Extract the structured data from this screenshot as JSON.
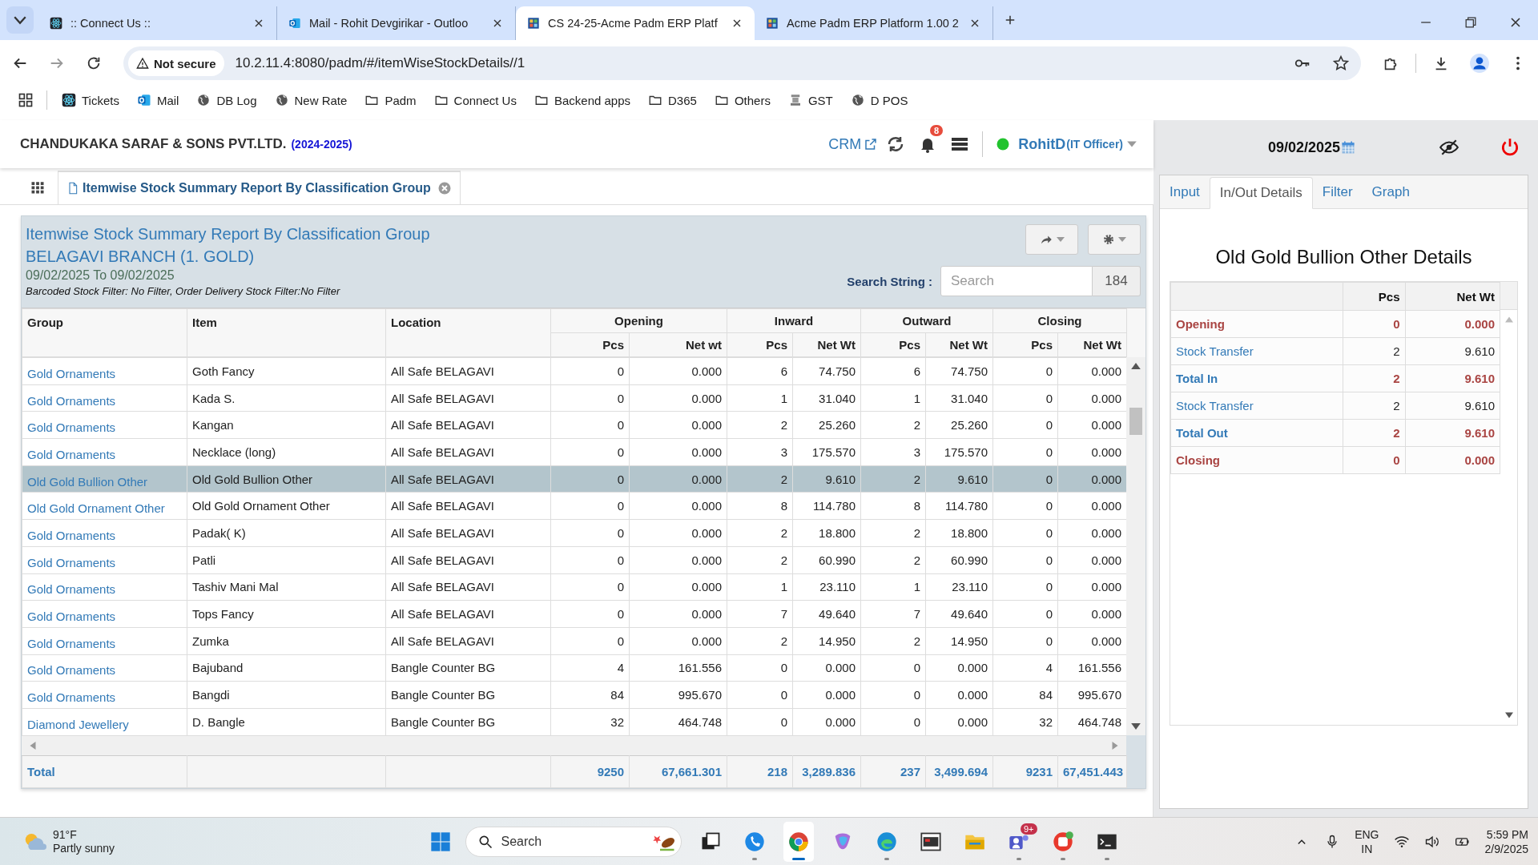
{
  "browser": {
    "tabs": [
      {
        "title": ":: Connect Us ::",
        "selected": false
      },
      {
        "title": "Mail - Rohit Devgirikar - Outloo",
        "selected": false
      },
      {
        "title": "CS 24-25-Acme Padm ERP Platf",
        "selected": true
      },
      {
        "title": "Acme Padm ERP Platform 1.00 2",
        "selected": false
      }
    ],
    "address": {
      "security": "Not secure",
      "url": "10.2.11.4:8080/padm/#/itemWiseStockDetails//1"
    },
    "bookmarks": [
      {
        "label": "Tickets",
        "kind": "app"
      },
      {
        "label": "Mail",
        "kind": "mail"
      },
      {
        "label": "DB Log",
        "kind": "site"
      },
      {
        "label": "New Rate",
        "kind": "site"
      },
      {
        "label": "Padm",
        "kind": "folder"
      },
      {
        "label": "Connect Us",
        "kind": "folder"
      },
      {
        "label": "Backend apps",
        "kind": "folder"
      },
      {
        "label": "D365",
        "kind": "folder"
      },
      {
        "label": "Others",
        "kind": "folder"
      },
      {
        "label": "GST",
        "kind": "emblem"
      },
      {
        "label": "D POS",
        "kind": "site"
      }
    ]
  },
  "header": {
    "company": "CHANDUKAKA SARAF & SONS PVT.LTD.",
    "year": "(2024-2025)",
    "crm": "CRM",
    "notifications": "8",
    "user": "RohitD",
    "role": "(IT Officer)"
  },
  "page_tabs": [
    {
      "label": "Itemwise Stock Summary Report By Classification Group",
      "selected": true
    }
  ],
  "report": {
    "title": "Itemwise Stock Summary Report By Classification Group",
    "branch": "BELAGAVI BRANCH (1. GOLD)",
    "date_range": "09/02/2025 To 09/02/2025",
    "filter_note": "Barcoded Stock Filter: No Filter, Order Delivery Stock Filter:No Filter",
    "search_label": "Search String :",
    "search": {
      "placeholder": "Search"
    },
    "count": "184",
    "table": {
      "columns": [
        "Group",
        "Item",
        "Location"
      ],
      "column_groups": [
        {
          "label": "Opening",
          "columns": [
            "Pcs",
            "Net wt"
          ]
        },
        {
          "label": "Inward",
          "columns": [
            "Pcs",
            "Net Wt"
          ]
        },
        {
          "label": "Outward",
          "columns": [
            "Pcs",
            "Net Wt"
          ]
        },
        {
          "label": "Closing",
          "columns": [
            "Pcs",
            "Net Wt"
          ]
        }
      ],
      "rows": [
        {
          "group": "Gold Ornaments",
          "item": "Goth Fancy",
          "location": "All Safe BELAGAVI",
          "values": [
            "0",
            "0.000",
            "6",
            "74.750",
            "6",
            "74.750",
            "0",
            "0.000"
          ],
          "selected": false
        },
        {
          "group": "Gold Ornaments",
          "item": "Kada S.",
          "location": "All Safe BELAGAVI",
          "values": [
            "0",
            "0.000",
            "1",
            "31.040",
            "1",
            "31.040",
            "0",
            "0.000"
          ],
          "selected": false
        },
        {
          "group": "Gold Ornaments",
          "item": "Kangan",
          "location": "All Safe BELAGAVI",
          "values": [
            "0",
            "0.000",
            "2",
            "25.260",
            "2",
            "25.260",
            "0",
            "0.000"
          ],
          "selected": false
        },
        {
          "group": "Gold Ornaments",
          "item": "Necklace (long)",
          "location": "All Safe BELAGAVI",
          "values": [
            "0",
            "0.000",
            "3",
            "175.570",
            "3",
            "175.570",
            "0",
            "0.000"
          ],
          "selected": false
        },
        {
          "group": "Old Gold Bullion Other",
          "item": "Old Gold Bullion Other",
          "location": "All Safe BELAGAVI",
          "values": [
            "0",
            "0.000",
            "2",
            "9.610",
            "2",
            "9.610",
            "0",
            "0.000"
          ],
          "selected": true
        },
        {
          "group": "Old Gold Ornament Other",
          "item": "Old Gold Ornament Other",
          "location": "All Safe BELAGAVI",
          "values": [
            "0",
            "0.000",
            "8",
            "114.780",
            "8",
            "114.780",
            "0",
            "0.000"
          ],
          "selected": false
        },
        {
          "group": "Gold Ornaments",
          "item": "Padak( K)",
          "location": "All Safe BELAGAVI",
          "values": [
            "0",
            "0.000",
            "2",
            "18.800",
            "2",
            "18.800",
            "0",
            "0.000"
          ],
          "selected": false
        },
        {
          "group": "Gold Ornaments",
          "item": "Patli",
          "location": "All Safe BELAGAVI",
          "values": [
            "0",
            "0.000",
            "2",
            "60.990",
            "2",
            "60.990",
            "0",
            "0.000"
          ],
          "selected": false
        },
        {
          "group": "Gold Ornaments",
          "item": "Tashiv Mani Mal",
          "location": "All Safe BELAGAVI",
          "values": [
            "0",
            "0.000",
            "1",
            "23.110",
            "1",
            "23.110",
            "0",
            "0.000"
          ],
          "selected": false
        },
        {
          "group": "Gold Ornaments",
          "item": "Tops Fancy",
          "location": "All Safe BELAGAVI",
          "values": [
            "0",
            "0.000",
            "7",
            "49.640",
            "7",
            "49.640",
            "0",
            "0.000"
          ],
          "selected": false
        },
        {
          "group": "Gold Ornaments",
          "item": "Zumka",
          "location": "All Safe BELAGAVI",
          "values": [
            "0",
            "0.000",
            "2",
            "14.950",
            "2",
            "14.950",
            "0",
            "0.000"
          ],
          "selected": false
        },
        {
          "group": "Gold Ornaments",
          "item": "Bajuband",
          "location": "Bangle Counter BG",
          "values": [
            "4",
            "161.556",
            "0",
            "0.000",
            "0",
            "0.000",
            "4",
            "161.556"
          ],
          "selected": false
        },
        {
          "group": "Gold Ornaments",
          "item": "Bangdi",
          "location": "Bangle Counter BG",
          "values": [
            "84",
            "995.670",
            "0",
            "0.000",
            "0",
            "0.000",
            "84",
            "995.670"
          ],
          "selected": false
        },
        {
          "group": "Diamond Jewellery",
          "item": "D. Bangle",
          "location": "Bangle Counter BG",
          "values": [
            "32",
            "464.748",
            "0",
            "0.000",
            "0",
            "0.000",
            "32",
            "464.748"
          ],
          "selected": false
        }
      ],
      "total": {
        "label": "Total",
        "values": [
          "9250",
          "67,661.301",
          "218",
          "3,289.836",
          "237",
          "3,499.694",
          "9231",
          "67,451.443"
        ]
      }
    }
  },
  "side": {
    "date": "09/02/2025",
    "tabs": [
      {
        "label": "Input",
        "selected": false
      },
      {
        "label": "In/Out Details",
        "selected": true
      },
      {
        "label": "Filter",
        "selected": false
      },
      {
        "label": "Graph",
        "selected": false
      }
    ],
    "title": "Old Gold Bullion Other Details",
    "columns": [
      "Pcs",
      "Net Wt"
    ],
    "rows": [
      {
        "label": "Opening",
        "kind": "balance",
        "pcs": "0",
        "net_wt": "0.000"
      },
      {
        "label": "Stock Transfer",
        "kind": "entry",
        "pcs": "2",
        "net_wt": "9.610"
      },
      {
        "label": "Total In",
        "kind": "total",
        "pcs": "2",
        "net_wt": "9.610"
      },
      {
        "label": "Stock Transfer",
        "kind": "entry",
        "pcs": "2",
        "net_wt": "9.610"
      },
      {
        "label": "Total Out",
        "kind": "total",
        "pcs": "2",
        "net_wt": "9.610"
      },
      {
        "label": "Closing",
        "kind": "balance",
        "pcs": "0",
        "net_wt": "0.000"
      }
    ]
  },
  "taskbar": {
    "weather": {
      "temp": "91°F",
      "condition": "Partly sunny"
    },
    "search": {
      "placeholder": "Search"
    },
    "apps": [
      {
        "kind": "task-view",
        "running": false,
        "selected": false
      },
      {
        "kind": "phone",
        "running": true,
        "selected": false
      },
      {
        "kind": "browser",
        "running": true,
        "selected": true
      },
      {
        "kind": "swirl",
        "running": false,
        "selected": false
      },
      {
        "kind": "wave",
        "running": true,
        "selected": false
      },
      {
        "kind": "monitor",
        "running": false,
        "selected": false
      },
      {
        "kind": "folder",
        "running": false,
        "selected": false
      },
      {
        "kind": "people",
        "running": true,
        "selected": false,
        "badge": "9+"
      },
      {
        "kind": "office",
        "running": true,
        "selected": false
      },
      {
        "kind": "terminal",
        "running": true,
        "selected": false
      }
    ],
    "tray": {
      "language": "ENG",
      "region": "IN",
      "time": "5:59 PM",
      "date": "2/9/2025"
    }
  }
}
